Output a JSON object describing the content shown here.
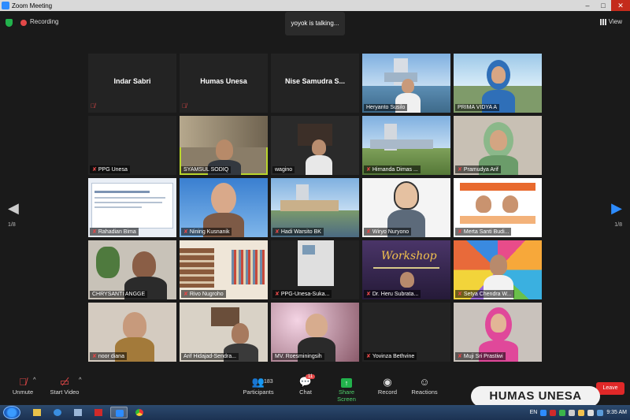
{
  "window": {
    "title": "Zoom Meeting",
    "minimize": "–",
    "maximize": "□",
    "close": "✕"
  },
  "topbar": {
    "recording_label": "Recording",
    "talking": "yoyok is talking...",
    "view_label": "View"
  },
  "pager": {
    "left_page": "1/8",
    "right_page": "1/8",
    "left_arrow": "◀",
    "right_arrow": "▶"
  },
  "tiles": [
    {
      "name": "Indar Sabri",
      "kind": "name"
    },
    {
      "name": "Humas Unesa",
      "kind": "name"
    },
    {
      "name": "Nise Samudra S...",
      "kind": "name"
    },
    {
      "name": "Heryanto Susilo",
      "kind": "video"
    },
    {
      "name": "PRIMA VIDYA A",
      "kind": "video"
    },
    {
      "name": "PPG Unesa",
      "kind": "blank"
    },
    {
      "name": "SYAMSUL SODIQ",
      "kind": "video"
    },
    {
      "name": "wagino",
      "kind": "video"
    },
    {
      "name": "Hirnanda Dimas ...",
      "kind": "video"
    },
    {
      "name": "Pramudya Arif",
      "kind": "video"
    },
    {
      "name": "Rahadian Bima",
      "kind": "video"
    },
    {
      "name": "Nining Kusnanik",
      "kind": "video"
    },
    {
      "name": "Hadi Warsito BK",
      "kind": "video"
    },
    {
      "name": "Wiryo Nuryono",
      "kind": "video"
    },
    {
      "name": "Merta Santi Budi...",
      "kind": "video"
    },
    {
      "name": "CHRYSANTI ANGGE",
      "kind": "video"
    },
    {
      "name": "Rivo Nugroho",
      "kind": "video"
    },
    {
      "name": "PPG-Unesa-Suka...",
      "kind": "video"
    },
    {
      "name": "Dr. Heru Subrata...",
      "kind": "video"
    },
    {
      "name": "Setya Chendra W...",
      "kind": "video"
    },
    {
      "name": "noor diana",
      "kind": "video"
    },
    {
      "name": "Arif Hidajad-Sendra...",
      "kind": "video"
    },
    {
      "name": "MV. Roesminingsih",
      "kind": "video"
    },
    {
      "name": "Yovinza Bethvine",
      "kind": "blank"
    },
    {
      "name": "Muji Sri Prastiwi",
      "kind": "video"
    }
  ],
  "toolbar": {
    "unmute": "Unmute",
    "start_video": "Start Video",
    "participants": "Participants",
    "participants_count": "183",
    "chat": "Chat",
    "chat_badge": "11",
    "share_screen": "Share Screen",
    "record": "Record",
    "reactions": "Reactions",
    "leave": "Leave"
  },
  "watermark": "HUMAS UNESA",
  "workshop_text": "Workshop",
  "taskbar": {
    "lang": "EN",
    "time": "9:35 AM"
  },
  "colors": {
    "accent": "#2d8cff",
    "active_speaker": "#b9d52c",
    "mute": "#e34848",
    "share": "#22b24c",
    "leave": "#e02828"
  }
}
